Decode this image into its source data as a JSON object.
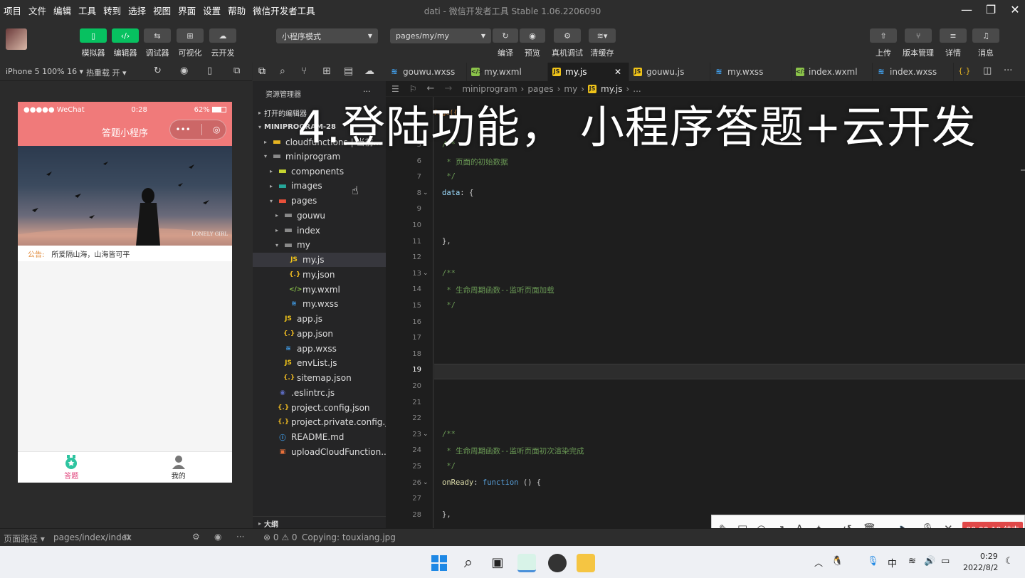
{
  "menu": [
    "项目",
    "文件",
    "编辑",
    "工具",
    "转到",
    "选择",
    "视图",
    "界面",
    "设置",
    "帮助",
    "微信开发者工具"
  ],
  "window_title": "dati - 微信开发者工具 Stable 1.06.2206090",
  "toolbar": {
    "simulator": "模拟器",
    "editor": "编辑器",
    "debugger": "调试器",
    "visual": "可视化",
    "cloud": "云开发",
    "mode": "小程序模式",
    "page_path": "pages/my/my",
    "compile": "编译",
    "preview": "预览",
    "real_debug": "真机调试",
    "clear_cache": "清缓存",
    "upload": "上传",
    "version": "版本管理",
    "details": "详情",
    "messages": "消息"
  },
  "simbar": {
    "device": "iPhone 5 100% 16 ▾",
    "hot_reload": "热重载 开 ▾"
  },
  "phone": {
    "carrier": "●●●●● WeChat",
    "time": "0:28",
    "battery": "62%",
    "nav_title": "答题小程序",
    "banner_caption": "LONELY GIRL",
    "notice_label": "公告:",
    "notice_text": "所爱隔山海，山海皆可平",
    "tab1": "答题",
    "tab2": "我的"
  },
  "explorer": {
    "header": "资源管理器",
    "more": "···",
    "open_editors": "打开的编辑器",
    "project": "MINIPROGRAM-28",
    "outline": "大纲",
    "tree": [
      {
        "label": "cloudfunctions | 当前...",
        "type": "folder-cloud",
        "depth": 1,
        "arrow": "▸"
      },
      {
        "label": "miniprogram",
        "type": "folder",
        "depth": 1,
        "arrow": "▾"
      },
      {
        "label": "components",
        "type": "folder-comp",
        "depth": 2,
        "arrow": "▸"
      },
      {
        "label": "images",
        "type": "folder-img",
        "depth": 2,
        "arrow": "▸"
      },
      {
        "label": "pages",
        "type": "folder-pages",
        "depth": 2,
        "arrow": "▾"
      },
      {
        "label": "gouwu",
        "type": "folder",
        "depth": 3,
        "arrow": "▸"
      },
      {
        "label": "index",
        "type": "folder",
        "depth": 3,
        "arrow": "▸"
      },
      {
        "label": "my",
        "type": "folder",
        "depth": 3,
        "arrow": "▾"
      },
      {
        "label": "my.js",
        "type": "js",
        "depth": 4,
        "arrow": "",
        "selected": true
      },
      {
        "label": "my.json",
        "type": "json",
        "depth": 4,
        "arrow": ""
      },
      {
        "label": "my.wxml",
        "type": "wxml",
        "depth": 4,
        "arrow": ""
      },
      {
        "label": "my.wxss",
        "type": "wxss",
        "depth": 4,
        "arrow": ""
      },
      {
        "label": "app.js",
        "type": "js",
        "depth": 3,
        "arrow": ""
      },
      {
        "label": "app.json",
        "type": "json",
        "depth": 3,
        "arrow": ""
      },
      {
        "label": "app.wxss",
        "type": "wxss",
        "depth": 3,
        "arrow": ""
      },
      {
        "label": "envList.js",
        "type": "js",
        "depth": 3,
        "arrow": ""
      },
      {
        "label": "sitemap.json",
        "type": "json",
        "depth": 3,
        "arrow": ""
      },
      {
        "label": ".eslintrc.js",
        "type": "eslint",
        "depth": 2,
        "arrow": ""
      },
      {
        "label": "project.config.json",
        "type": "json",
        "depth": 2,
        "arrow": ""
      },
      {
        "label": "project.private.config.js...",
        "type": "json",
        "depth": 2,
        "arrow": ""
      },
      {
        "label": "README.md",
        "type": "info",
        "depth": 2,
        "arrow": ""
      },
      {
        "label": "uploadCloudFunction....",
        "type": "sh",
        "depth": 2,
        "arrow": ""
      }
    ]
  },
  "tabs": [
    {
      "label": "gouwu.wxss",
      "type": "wxss"
    },
    {
      "label": "my.wxml",
      "type": "wxml"
    },
    {
      "label": "my.js",
      "type": "js",
      "active": true
    },
    {
      "label": "gouwu.js",
      "type": "js"
    },
    {
      "label": "my.wxss",
      "type": "wxss"
    },
    {
      "label": "index.wxml",
      "type": "wxml"
    },
    {
      "label": "index.wxss",
      "type": "wxss"
    }
  ],
  "breadcrumb": [
    "miniprogram",
    "pages",
    "my",
    "my.js",
    "..."
  ],
  "editor": {
    "page_token": "Page({",
    "current_line": "19",
    "lines": [
      {
        "n": "5",
        "fold": true,
        "parts": [
          [
            "c-com",
            "/**"
          ]
        ]
      },
      {
        "n": "6",
        "parts": [
          [
            "c-com",
            " * 页面的初始数据"
          ]
        ]
      },
      {
        "n": "7",
        "parts": [
          [
            "c-com",
            " */"
          ]
        ]
      },
      {
        "n": "8",
        "fold": true,
        "parts": [
          [
            "c-key",
            "data"
          ],
          [
            "c-pun",
            ": {"
          ]
        ]
      },
      {
        "n": "9",
        "parts": []
      },
      {
        "n": "10",
        "parts": []
      },
      {
        "n": "11",
        "parts": [
          [
            "c-pun",
            "},"
          ]
        ]
      },
      {
        "n": "12",
        "parts": []
      },
      {
        "n": "13",
        "fold": true,
        "parts": [
          [
            "c-com",
            "/**"
          ]
        ]
      },
      {
        "n": "14",
        "parts": [
          [
            "c-com",
            " * 生命周期函数--监听页面加载"
          ]
        ]
      },
      {
        "n": "15",
        "parts": [
          [
            "c-com",
            " */"
          ]
        ]
      },
      {
        "n": "16",
        "parts": []
      },
      {
        "n": "17",
        "parts": []
      },
      {
        "n": "18",
        "parts": []
      },
      {
        "n": "19",
        "parts": []
      },
      {
        "n": "20",
        "parts": []
      },
      {
        "n": "21",
        "parts": []
      },
      {
        "n": "22",
        "parts": []
      },
      {
        "n": "23",
        "fold": true,
        "parts": [
          [
            "c-com",
            "/**"
          ]
        ]
      },
      {
        "n": "24",
        "parts": [
          [
            "c-com",
            " * 生命周期函数--监听页面初次渲染完成"
          ]
        ]
      },
      {
        "n": "25",
        "parts": [
          [
            "c-com",
            " */"
          ]
        ]
      },
      {
        "n": "26",
        "fold": true,
        "parts": [
          [
            "c-fn",
            "onReady"
          ],
          [
            "c-pun",
            ": "
          ],
          [
            "c-kw",
            "function"
          ],
          [
            "c-pun",
            " () {"
          ]
        ]
      },
      {
        "n": "27",
        "parts": []
      },
      {
        "n": "28",
        "parts": [
          [
            "c-pun",
            "},"
          ]
        ]
      }
    ]
  },
  "statusbar": {
    "page_path_label": "页面路径 ▾",
    "page_path": "pages/index/index",
    "errors": "⊗ 0 ⚠ 0",
    "message": "Copying: touxiang.jpg"
  },
  "recorder": {
    "timer": "00:00:19 结束"
  },
  "taskbar": {
    "time": "0:29",
    "date": "2022/8/2",
    "ime": "中"
  },
  "overlay_title": "4.登陆功能， 小程序答题+云开发"
}
